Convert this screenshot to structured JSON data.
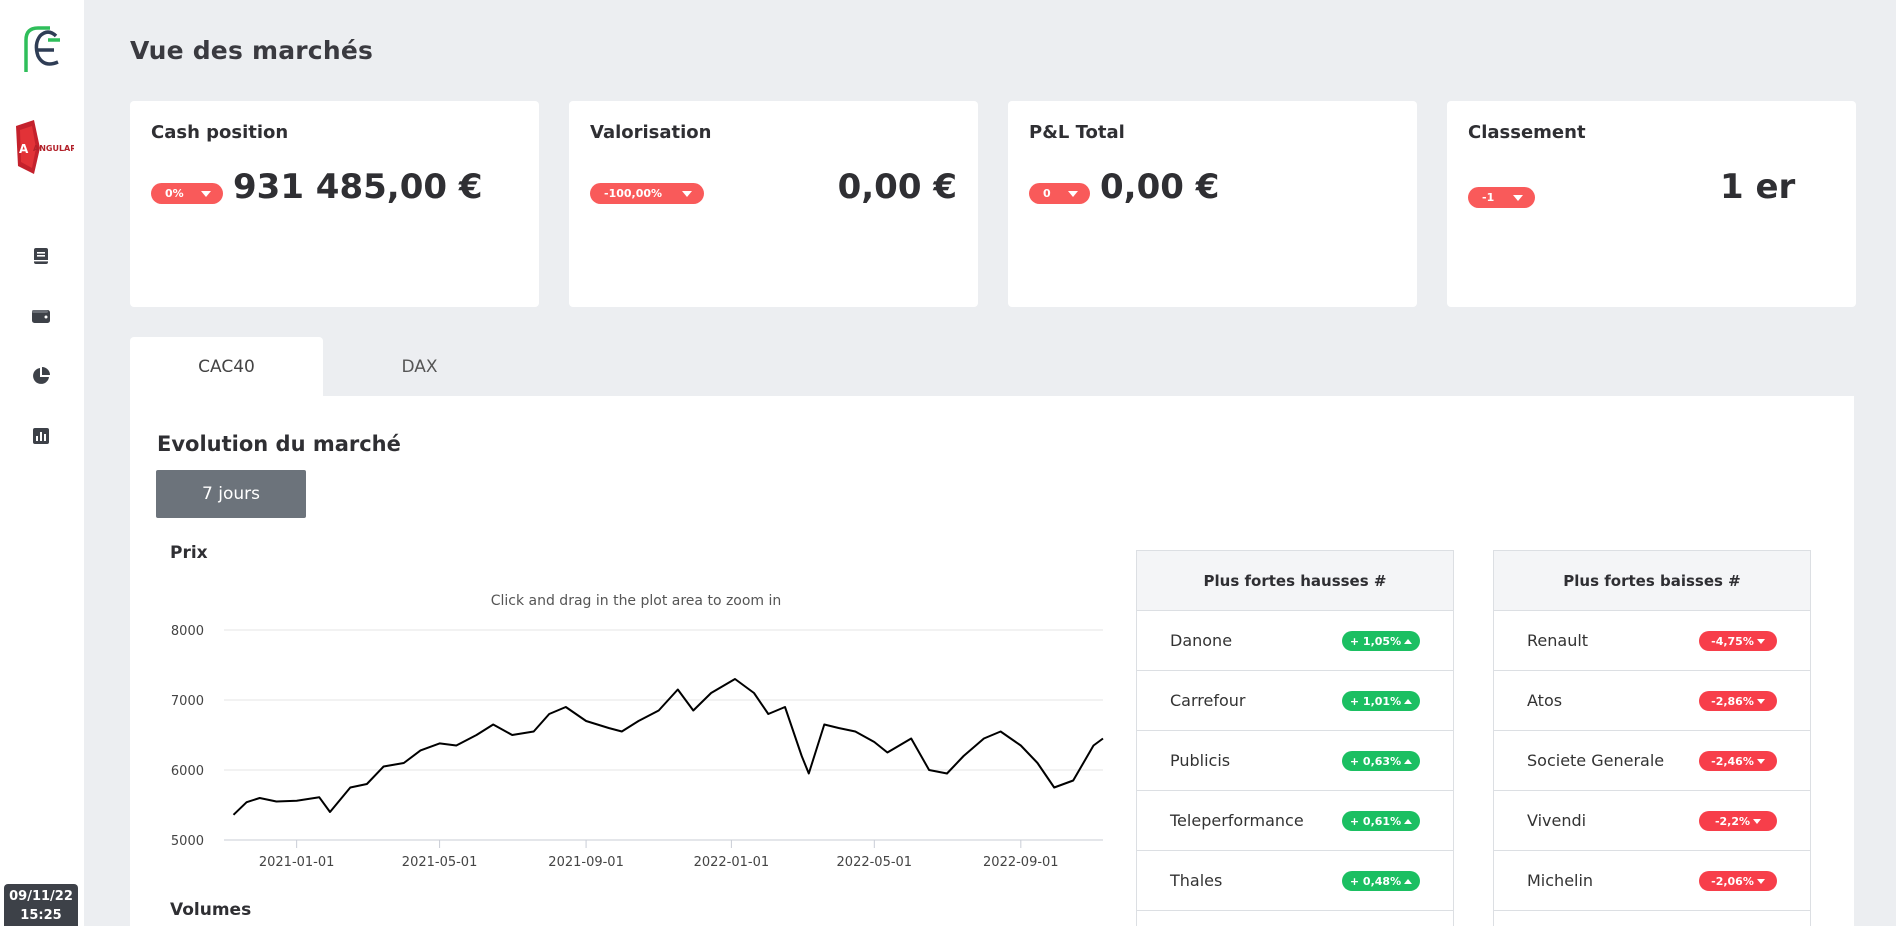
{
  "sidebar": {
    "logo_text": "FE",
    "angular_logo_text": "ANGULARJS",
    "icons": [
      "book-icon",
      "wallet-icon",
      "pie-chart-icon",
      "bar-chart-icon"
    ],
    "date": "09/11/22",
    "time": "15:25"
  },
  "page": {
    "title": "Vue des marchés"
  },
  "cards": [
    {
      "title": "Cash position",
      "badge": "0%",
      "value": "931 485,00 €"
    },
    {
      "title": "Valorisation",
      "badge": "-100,00%",
      "value": "0,00 €"
    },
    {
      "title": "P&L Total",
      "badge": "0",
      "value": "0,00 €"
    },
    {
      "title": "Classement",
      "badge": "-1",
      "value": "1 er"
    }
  ],
  "tabs": [
    {
      "label": "CAC40",
      "active": true
    },
    {
      "label": "DAX",
      "active": false
    }
  ],
  "market": {
    "section_title": "Evolution du marché",
    "period_button": "7 jours",
    "price_label": "Prix",
    "volume_label": "Volumes"
  },
  "chart_data": {
    "type": "line",
    "title": "",
    "subtitle": "Click and drag in the plot area to zoom in",
    "xlabel": "",
    "ylabel": "Prix",
    "ylim": [
      5000,
      8000
    ],
    "yticks": [
      "5000",
      "6000",
      "7000",
      "8000"
    ],
    "xticks": [
      "2021-01-01",
      "2021-05-01",
      "2021-09-01",
      "2022-01-01",
      "2022-05-01",
      "2022-09-01"
    ],
    "xlim": [
      "2020-11-01",
      "2022-11-09"
    ],
    "grid": true,
    "color": "#000000",
    "series": [
      {
        "x": [
          "2020-11-09",
          "2020-11-20",
          "2020-12-01",
          "2020-12-15",
          "2021-01-01",
          "2021-01-20",
          "2021-01-29",
          "2021-02-15",
          "2021-03-01",
          "2021-03-15",
          "2021-04-01",
          "2021-04-15",
          "2021-05-01",
          "2021-05-15",
          "2021-06-01",
          "2021-06-15",
          "2021-07-01",
          "2021-07-19",
          "2021-08-01",
          "2021-08-15",
          "2021-09-01",
          "2021-09-20",
          "2021-10-01",
          "2021-10-15",
          "2021-11-01",
          "2021-11-17",
          "2021-11-30",
          "2021-12-15",
          "2022-01-04",
          "2022-01-20",
          "2022-02-01",
          "2022-02-15",
          "2022-03-01",
          "2022-03-07",
          "2022-03-20",
          "2022-04-01",
          "2022-04-15",
          "2022-05-01",
          "2022-05-12",
          "2022-06-01",
          "2022-06-16",
          "2022-07-01",
          "2022-07-15",
          "2022-08-01",
          "2022-08-15",
          "2022-09-01",
          "2022-09-15",
          "2022-09-29",
          "2022-10-15",
          "2022-11-01",
          "2022-11-09"
        ],
        "values": [
          5360,
          5540,
          5600,
          5550,
          5560,
          5610,
          5400,
          5750,
          5800,
          6050,
          6100,
          6280,
          6380,
          6350,
          6500,
          6650,
          6500,
          6550,
          6800,
          6900,
          6700,
          6600,
          6550,
          6700,
          6850,
          7150,
          6850,
          7100,
          7300,
          7100,
          6800,
          6900,
          6200,
          5950,
          6650,
          6600,
          6550,
          6400,
          6250,
          6450,
          6000,
          5950,
          6200,
          6450,
          6550,
          6350,
          6100,
          5750,
          5850,
          6350,
          6450
        ]
      }
    ]
  },
  "gainers": {
    "title": "Plus fortes hausses #",
    "rows": [
      {
        "name": "Danone",
        "change": "+ 1,05%"
      },
      {
        "name": "Carrefour",
        "change": "+ 1,01%"
      },
      {
        "name": "Publicis",
        "change": "+ 0,63%"
      },
      {
        "name": "Teleperformance",
        "change": "+ 0,61%"
      },
      {
        "name": "Thales",
        "change": "+ 0,48%"
      }
    ]
  },
  "losers": {
    "title": "Plus fortes baisses #",
    "rows": [
      {
        "name": "Renault",
        "change": "-4,75%"
      },
      {
        "name": "Atos",
        "change": "-2,86%"
      },
      {
        "name": "Societe Generale",
        "change": "-2,46%"
      },
      {
        "name": "Vivendi",
        "change": "-2,2%"
      },
      {
        "name": "Michelin",
        "change": "-2,06%"
      }
    ]
  },
  "colors": {
    "badge_red": "#f95a5a",
    "up_green": "#1bbf62",
    "down_red": "#f73e4a",
    "button_gray": "#6c737b"
  }
}
